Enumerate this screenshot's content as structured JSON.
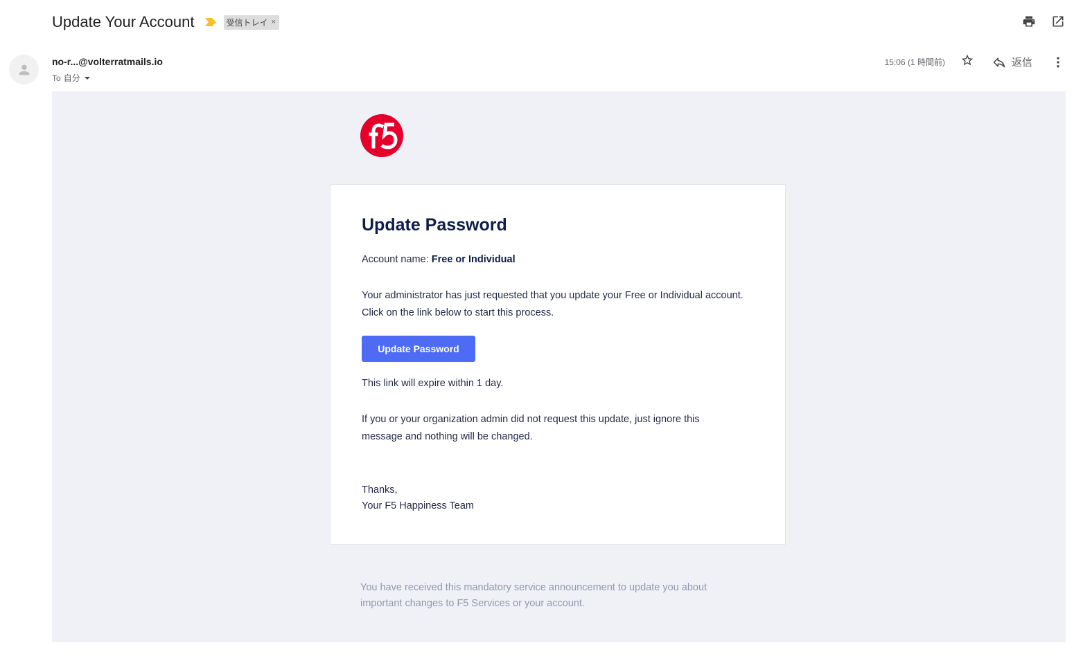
{
  "header": {
    "subject": "Update Your Account",
    "label": "受信トレイ",
    "label_close": "×"
  },
  "message": {
    "sender": "no-r...@volterratmails.io",
    "to_prefix": "To",
    "to_recipient": "自分",
    "time": "15:06 (1 時間前)",
    "reply_label": "返信"
  },
  "email": {
    "title": "Update Password",
    "account_label": "Account name:",
    "account_value": "Free or Individual",
    "body_line1": "Your administrator has just requested that you update your Free or Individual account. Click on the link below to start this process.",
    "button_label": "Update Password",
    "expiry": "This link will expire within 1 day.",
    "ignore_note": "If you or your organization admin did not request this update, just ignore this message and nothing will be changed.",
    "signoff": "Thanks,",
    "team": "Your F5 Happiness Team",
    "footer": "You have received this mandatory service announcement to update you about important changes to F5 Services or your account."
  },
  "colors": {
    "accent_button": "#4d6bf5",
    "title_navy": "#0e1d4a",
    "logo_red": "#e4002b",
    "importance_yellow": "#f6c026",
    "body_bg": "#f0f1f6"
  },
  "icons": [
    "importance-marker-icon",
    "print-icon",
    "open-in-new-window-icon",
    "person-icon",
    "chevron-down-icon",
    "star-icon",
    "reply-icon",
    "more-vert-icon",
    "f5-logo"
  ]
}
